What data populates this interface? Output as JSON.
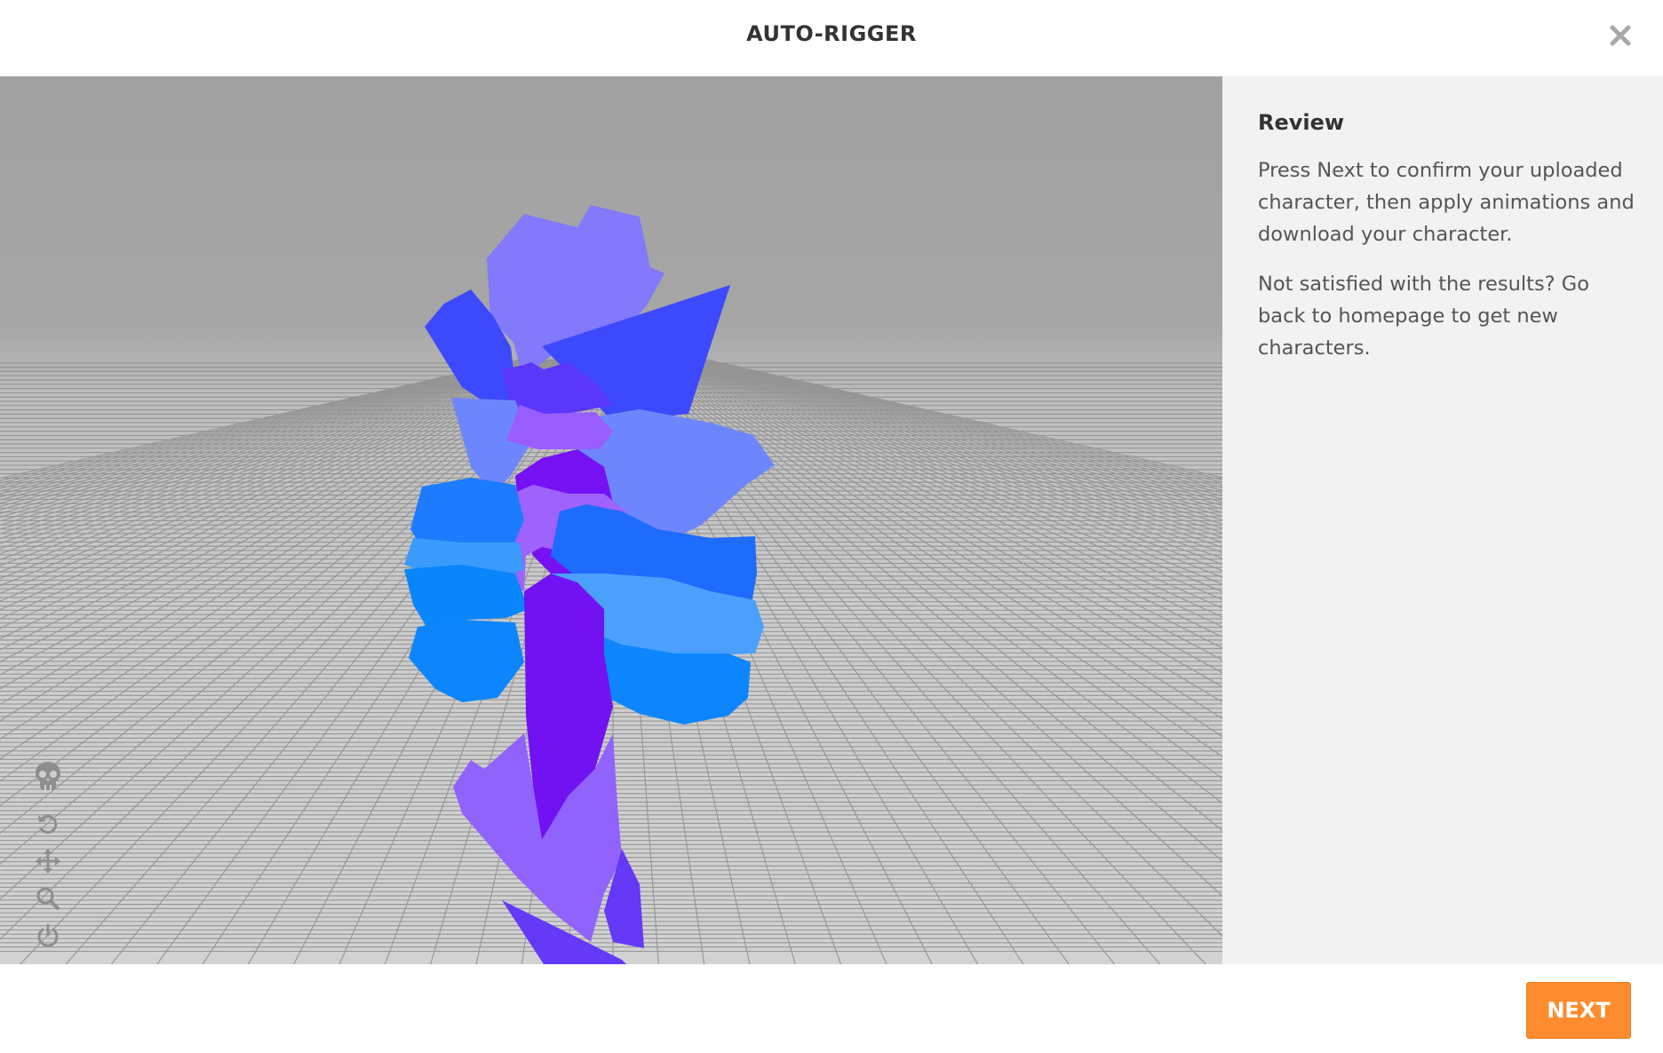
{
  "header": {
    "title": "AUTO-RIGGER",
    "close_icon": "close-icon"
  },
  "viewport": {
    "tools": [
      {
        "name": "skeleton-toggle",
        "icon": "skull-icon"
      },
      {
        "name": "reset-view",
        "icon": "rotate-ccw-icon"
      },
      {
        "name": "pan",
        "icon": "move-arrows-icon"
      },
      {
        "name": "zoom",
        "icon": "search-icon"
      },
      {
        "name": "power",
        "icon": "power-icon"
      },
      {
        "name": "camera",
        "icon": "video-camera-icon"
      }
    ],
    "colors": {
      "sky": "#a1a1a1",
      "floor": "#cccccc",
      "grid": "#8f8f8f",
      "mesh_light_purple": "#8279fd",
      "mesh_blue": "#3d49fd",
      "mesh_violet": "#7611f3",
      "mesh_azure": "#0d86fd"
    }
  },
  "panel": {
    "heading": "Review",
    "paragraph1": "Press Next to confirm your uploaded character, then apply animations and download your character.",
    "paragraph2": "Not satisfied with the results? Go back to homepage to get new characters."
  },
  "footer": {
    "next_label": "NEXT"
  },
  "colors": {
    "accent": "#fd8c2f",
    "panel_bg": "#f2f2f2"
  }
}
